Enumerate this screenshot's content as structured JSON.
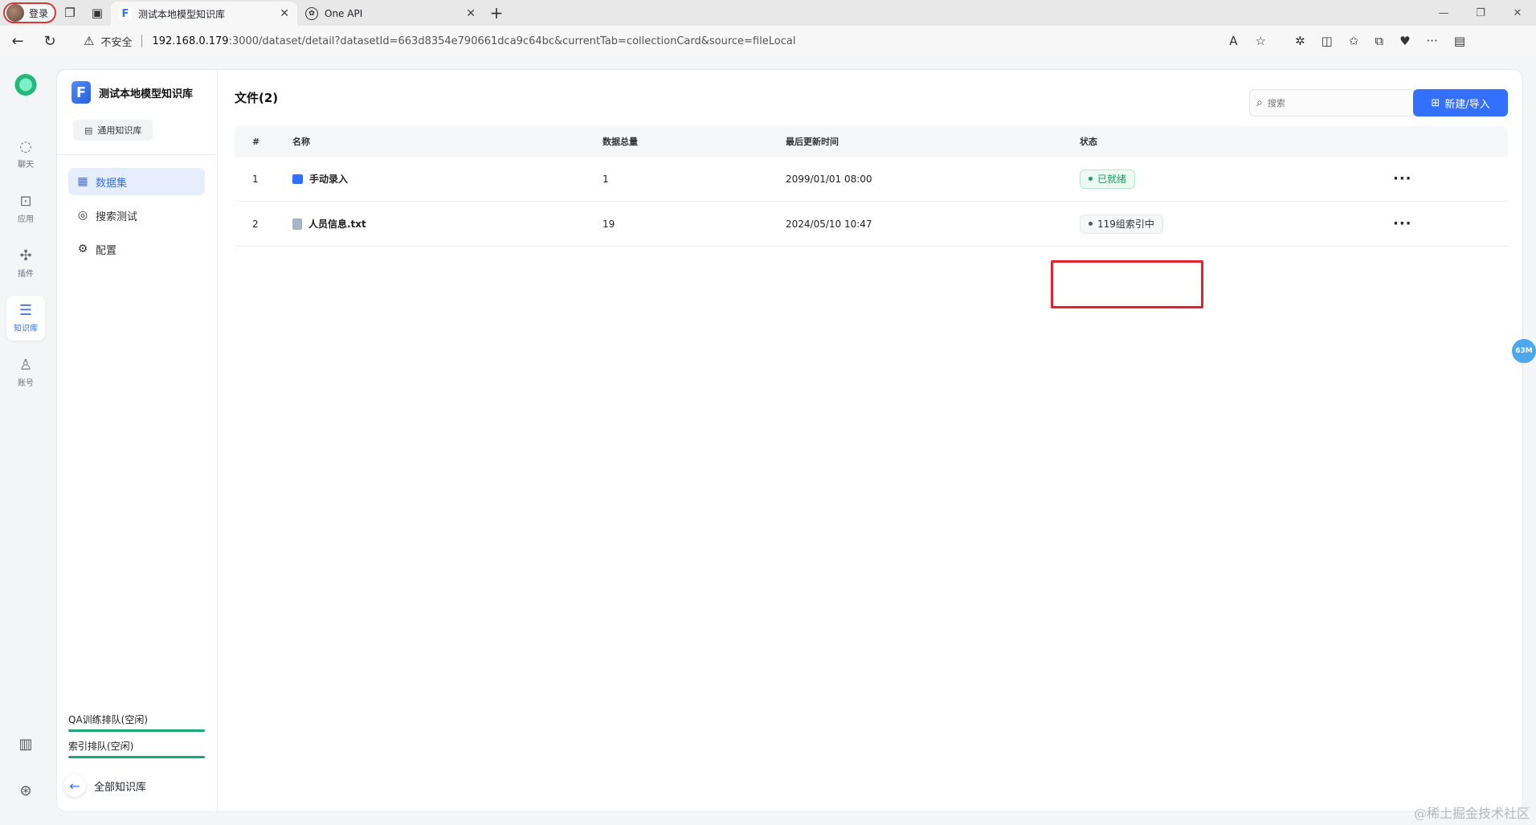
{
  "browser": {
    "profile_label": "登录",
    "tabs": [
      {
        "title": "测试本地模型知识库",
        "active": true
      },
      {
        "title": "One API",
        "active": false
      }
    ],
    "security_label": "不安全",
    "url_host": "192.168.0.179",
    "url_rest": ":3000/dataset/detail?datasetId=663d8354e790661dca9c64bc&currentTab=collectionCard&source=fileLocal"
  },
  "rail": {
    "items": [
      {
        "label": "聊天",
        "icon": "chat-icon"
      },
      {
        "label": "应用",
        "icon": "robot-icon"
      },
      {
        "label": "插件",
        "icon": "puzzle-icon"
      },
      {
        "label": "知识库",
        "icon": "database-icon",
        "active": true
      },
      {
        "label": "账号",
        "icon": "user-icon"
      }
    ]
  },
  "dataset": {
    "name": "测试本地模型知识库",
    "type_label": "通用知识库"
  },
  "nav": {
    "items": [
      {
        "label": "数据集",
        "icon": "bar-chart-icon",
        "active": true
      },
      {
        "label": "搜索测试",
        "icon": "target-icon"
      },
      {
        "label": "配置",
        "icon": "gear-icon"
      }
    ],
    "queues": [
      {
        "label": "QA训练排队(空闲)"
      },
      {
        "label": "索引排队(空闲)"
      }
    ],
    "back_label": "全部知识库"
  },
  "main": {
    "title": "文件(2)",
    "search_placeholder": "搜索",
    "create_label": "新建/导入",
    "columns": [
      "#",
      "名称",
      "数据总量",
      "最后更新时间",
      "状态"
    ],
    "rows": [
      {
        "index": "1",
        "name": "手动录入",
        "count": "1",
        "time": "2099/01/01 08:00",
        "status": "已就绪",
        "status_type": "ready"
      },
      {
        "index": "2",
        "name": "人员信息.txt",
        "count": "19",
        "time": "2024/05/10 10:47",
        "status": "119组索引中",
        "status_type": "indexing"
      }
    ]
  },
  "memory_badge": "63M",
  "watermark": "@稀土掘金技术社区",
  "colors": {
    "accent": "#3370ff",
    "ready": "#17a05d",
    "highlight": "#e3232c"
  }
}
